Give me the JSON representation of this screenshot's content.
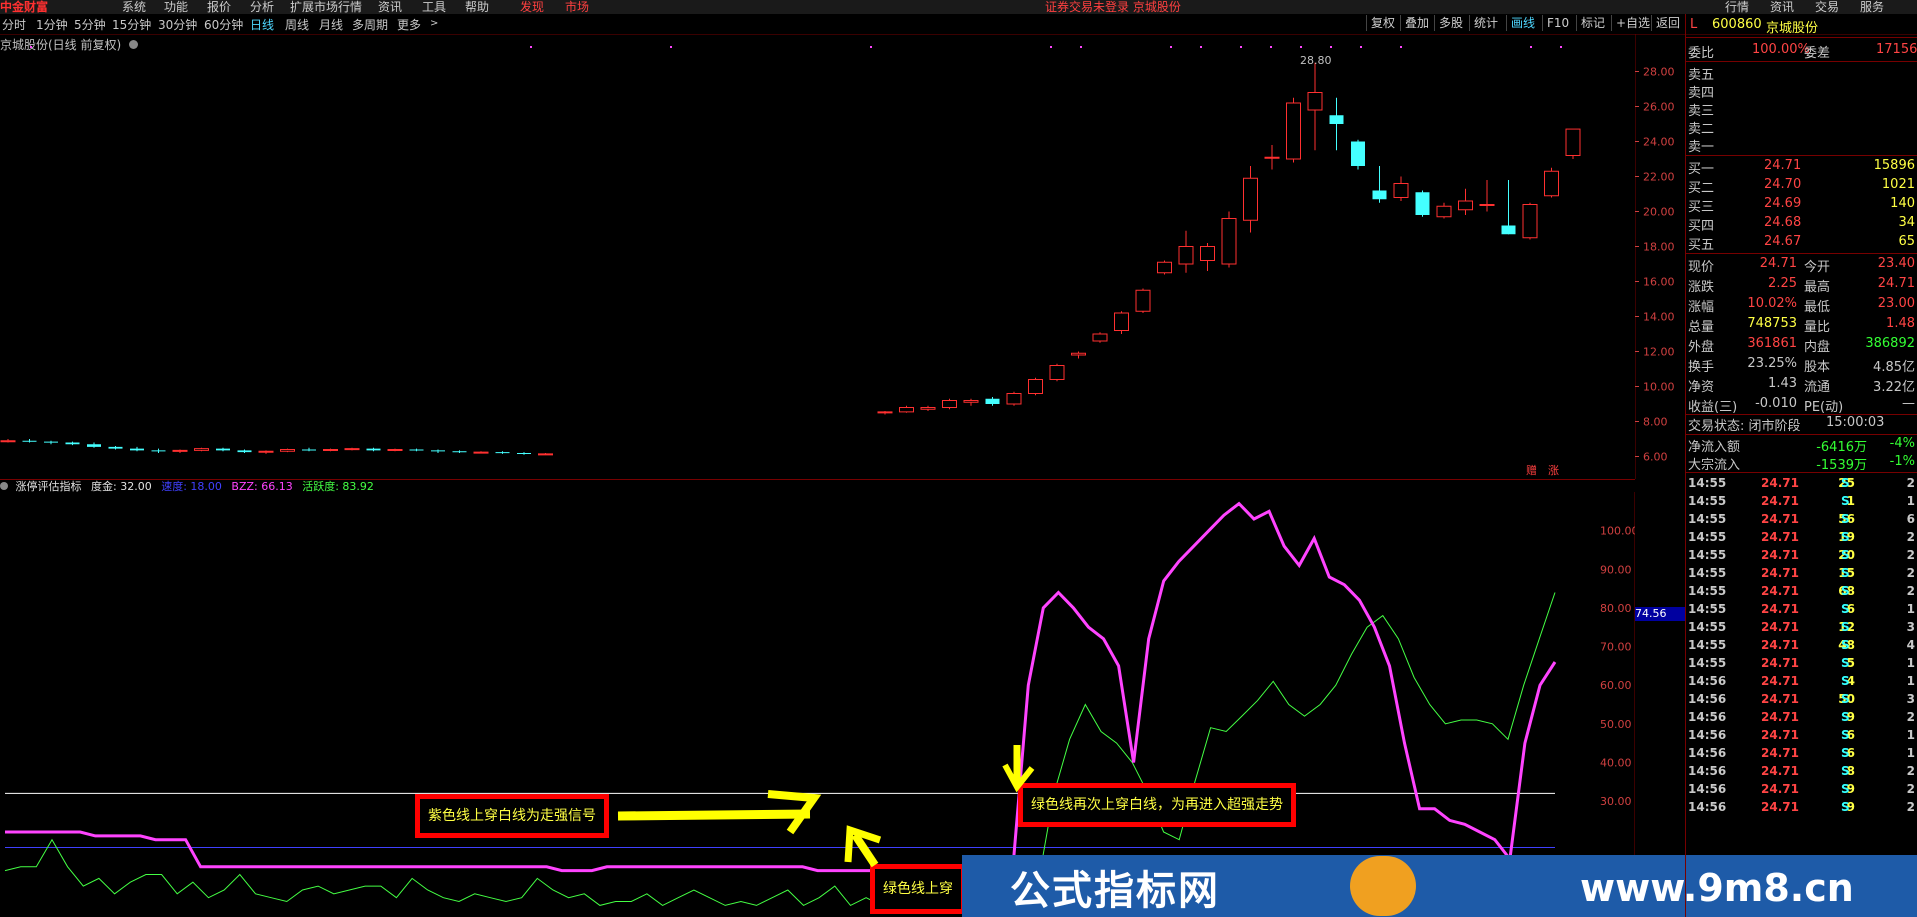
{
  "topbar": {
    "logo": "中金财富",
    "menus": [
      "系统",
      "功能",
      "报价",
      "分析",
      "扩展市场行情",
      "资讯",
      "工具",
      "帮助"
    ],
    "tabs": [
      "发现",
      "市场"
    ],
    "notice": "证券交易未登录 京城股份",
    "right_tabs": [
      "行情",
      "资讯",
      "交易",
      "服务"
    ]
  },
  "periods": {
    "items": [
      "分时",
      "1分钟",
      "5分钟",
      "15分钟",
      "30分钟",
      "60分钟",
      "日线",
      "周线",
      "月线",
      "多周期",
      "更多"
    ],
    "active": "日线",
    "right": [
      "复权",
      "叠加",
      "多股",
      "统计",
      "画线",
      "F10",
      "标记",
      "+自选",
      "返回"
    ]
  },
  "chart_title": "京城股份(日线 前复权)",
  "peak_label": "28.80",
  "indicator": {
    "name": "涨停评估指标",
    "items": [
      {
        "label": "度金: 32.00",
        "color": "#e0e0e0"
      },
      {
        "label": "速度: 18.00",
        "color": "#4040ff"
      },
      {
        "label": "BZZ: 66.13",
        "color": "#ff44ff"
      },
      {
        "label": "活跃度: 83.92",
        "color": "#44ff44"
      }
    ],
    "axis_tag": "74.56"
  },
  "bottom_tags": [
    "赠",
    "涨"
  ],
  "annotations": {
    "purple_cross": "紫色线上穿白线为走强信号",
    "purple_recross": "绿色线再次上穿白线，为再进入超强走势",
    "green_cross": "绿色线上穿"
  },
  "watermark": {
    "text": "公式指标网",
    "url": "www.9m8.cn"
  },
  "stock": {
    "code_prefix": "L",
    "code": "600860",
    "name": "京城股份",
    "weibi_label": "委比",
    "weibi": "100.00%",
    "weicha_label": "委差",
    "weicha": "17156"
  },
  "sell_levels": [
    "卖五",
    "卖四",
    "卖三",
    "卖二",
    "卖一"
  ],
  "buy_levels": [
    {
      "label": "买一",
      "price": "24.71",
      "vol": "15896"
    },
    {
      "label": "买二",
      "price": "24.70",
      "vol": "1021"
    },
    {
      "label": "买三",
      "price": "24.69",
      "vol": "140"
    },
    {
      "label": "买四",
      "price": "24.68",
      "vol": "34"
    },
    {
      "label": "买五",
      "price": "24.67",
      "vol": "65"
    }
  ],
  "quote": [
    {
      "l1": "现价",
      "v1": "24.71",
      "c1": "red",
      "l2": "今开",
      "v2": "23.40",
      "c2": "red"
    },
    {
      "l1": "涨跌",
      "v1": "2.25",
      "c1": "red",
      "l2": "最高",
      "v2": "24.71",
      "c2": "red"
    },
    {
      "l1": "涨幅",
      "v1": "10.02%",
      "c1": "red",
      "l2": "最低",
      "v2": "23.00",
      "c2": "red"
    },
    {
      "l1": "总量",
      "v1": "748753",
      "c1": "yel",
      "l2": "量比",
      "v2": "1.48",
      "c2": "red"
    },
    {
      "l1": "外盘",
      "v1": "361861",
      "c1": "red",
      "l2": "内盘",
      "v2": "386892",
      "c2": "grn"
    },
    {
      "l1": "换手",
      "v1": "23.25%",
      "c1": "lab",
      "l2": "股本",
      "v2": "4.85亿",
      "c2": "lab"
    },
    {
      "l1": "净资",
      "v1": "1.43",
      "c1": "lab",
      "l2": "流通",
      "v2": "3.22亿",
      "c2": "lab"
    },
    {
      "l1": "收益(三)",
      "v1": "-0.010",
      "c1": "lab",
      "l2": "PE(动)",
      "v2": "—",
      "c2": "lab"
    }
  ],
  "trade_state_label": "交易状态: 闭市阶段",
  "trade_state_time": "15:00:03",
  "flows": [
    {
      "label": "净流入额",
      "val": "-6416万",
      "pct": "-4%"
    },
    {
      "label": "大宗流入",
      "val": "-1539万",
      "pct": "-1%"
    }
  ],
  "ticks": [
    {
      "t": "14:55",
      "p": "24.71",
      "v": "25",
      "s": "S",
      "n": "2"
    },
    {
      "t": "14:55",
      "p": "24.71",
      "v": "1",
      "s": "S",
      "n": "1"
    },
    {
      "t": "14:55",
      "p": "24.71",
      "v": "56",
      "s": "S",
      "n": "6"
    },
    {
      "t": "14:55",
      "p": "24.71",
      "v": "19",
      "s": "S",
      "n": "2"
    },
    {
      "t": "14:55",
      "p": "24.71",
      "v": "20",
      "s": "S",
      "n": "2"
    },
    {
      "t": "14:55",
      "p": "24.71",
      "v": "15",
      "s": "S",
      "n": "2"
    },
    {
      "t": "14:55",
      "p": "24.71",
      "v": "68",
      "s": "S",
      "n": "2"
    },
    {
      "t": "14:55",
      "p": "24.71",
      "v": "6",
      "s": "S",
      "n": "1"
    },
    {
      "t": "14:55",
      "p": "24.71",
      "v": "12",
      "s": "S",
      "n": "3"
    },
    {
      "t": "14:55",
      "p": "24.71",
      "v": "48",
      "s": "S",
      "n": "4"
    },
    {
      "t": "14:55",
      "p": "24.71",
      "v": "5",
      "s": "S",
      "n": "1"
    },
    {
      "t": "14:56",
      "p": "24.71",
      "v": "4",
      "s": "S",
      "n": "1"
    },
    {
      "t": "14:56",
      "p": "24.71",
      "v": "50",
      "s": "S",
      "n": "3"
    },
    {
      "t": "14:56",
      "p": "24.71",
      "v": "9",
      "s": "S",
      "n": "2"
    },
    {
      "t": "14:56",
      "p": "24.71",
      "v": "6",
      "s": "S",
      "n": "1"
    },
    {
      "t": "14:56",
      "p": "24.71",
      "v": "6",
      "s": "S",
      "n": "1"
    },
    {
      "t": "14:56",
      "p": "24.71",
      "v": "8",
      "s": "S",
      "n": "2"
    },
    {
      "t": "14:56",
      "p": "24.71",
      "v": "9",
      "s": "S",
      "n": "2"
    },
    {
      "t": "14:56",
      "p": "24.71",
      "v": "9",
      "s": "S",
      "n": "2"
    }
  ],
  "chart_data": [
    {
      "type": "candlestick",
      "ylim": [
        5,
        29
      ],
      "y_ticks": [
        6,
        8,
        10,
        12,
        14,
        16,
        18,
        20,
        22,
        24,
        26,
        28
      ],
      "candles": [
        [
          6.9,
          7.0,
          6.8,
          6.9
        ],
        [
          6.9,
          7.0,
          6.8,
          6.85
        ],
        [
          6.85,
          6.9,
          6.7,
          6.8
        ],
        [
          6.8,
          6.85,
          6.65,
          6.7
        ],
        [
          6.7,
          6.8,
          6.5,
          6.55
        ],
        [
          6.55,
          6.6,
          6.4,
          6.45
        ],
        [
          6.45,
          6.55,
          6.3,
          6.35
        ],
        [
          6.35,
          6.45,
          6.2,
          6.3
        ],
        [
          6.3,
          6.4,
          6.2,
          6.35
        ],
        [
          6.35,
          6.5,
          6.3,
          6.45
        ],
        [
          6.45,
          6.5,
          6.3,
          6.35
        ],
        [
          6.35,
          6.4,
          6.2,
          6.25
        ],
        [
          6.25,
          6.35,
          6.15,
          6.3
        ],
        [
          6.3,
          6.45,
          6.25,
          6.4
        ],
        [
          6.4,
          6.5,
          6.3,
          6.35
        ],
        [
          6.35,
          6.45,
          6.3,
          6.4
        ],
        [
          6.4,
          6.5,
          6.35,
          6.45
        ],
        [
          6.45,
          6.5,
          6.3,
          6.35
        ],
        [
          6.35,
          6.45,
          6.3,
          6.4
        ],
        [
          6.4,
          6.45,
          6.3,
          6.35
        ],
        [
          6.35,
          6.4,
          6.2,
          6.3
        ],
        [
          6.3,
          6.35,
          6.2,
          6.25
        ],
        [
          6.25,
          6.3,
          6.2,
          6.25
        ],
        [
          6.25,
          6.3,
          6.15,
          6.2
        ],
        [
          6.2,
          6.25,
          6.1,
          6.15
        ],
        [
          6.15,
          6.2,
          6.1,
          6.15
        ],
        [
          6.15,
          6.2,
          6.1,
          6.12
        ],
        [
          6.12,
          6.2,
          6.1,
          6.15
        ],
        [
          6.15,
          6.2,
          6.1,
          6.15
        ],
        [
          6.15,
          6.2,
          6.1,
          6.15
        ],
        [
          6.15,
          6.2,
          6.1,
          6.15
        ],
        [
          6.15,
          6.2,
          6.1,
          6.15
        ],
        [
          6.15,
          6.2,
          6.1,
          6.15
        ],
        [
          6.15,
          6.2,
          6.1,
          6.15
        ],
        [
          6.15,
          6.2,
          6.1,
          6.15
        ],
        [
          6.15,
          6.2,
          6.1,
          6.15
        ],
        [
          6.15,
          6.2,
          6.1,
          6.15
        ],
        [
          6.15,
          6.2,
          6.1,
          6.15
        ],
        [
          6.15,
          6.2,
          6.1,
          6.15
        ],
        [
          6.15,
          6.2,
          6.1,
          6.15
        ],
        [
          8.5,
          8.6,
          8.4,
          8.55
        ],
        [
          8.55,
          8.9,
          8.5,
          8.8
        ],
        [
          8.7,
          8.9,
          8.6,
          8.8
        ],
        [
          8.8,
          9.3,
          8.7,
          9.2
        ],
        [
          9.1,
          9.3,
          8.9,
          9.2
        ],
        [
          9.3,
          9.4,
          8.9,
          9.0
        ],
        [
          9.0,
          9.7,
          8.9,
          9.6
        ],
        [
          9.6,
          10.5,
          9.5,
          10.4
        ],
        [
          10.4,
          11.3,
          10.3,
          11.2
        ],
        [
          11.8,
          12.0,
          11.6,
          11.9
        ],
        [
          12.6,
          13.1,
          12.5,
          13.0
        ],
        [
          13.2,
          14.3,
          13.0,
          14.2
        ],
        [
          14.3,
          15.6,
          14.2,
          15.5
        ],
        [
          16.5,
          17.2,
          16.4,
          17.1
        ],
        [
          17.0,
          18.9,
          16.5,
          18.0
        ],
        [
          17.2,
          18.2,
          16.6,
          18.0
        ],
        [
          17.0,
          20.0,
          16.8,
          19.6
        ],
        [
          19.5,
          22.6,
          18.8,
          21.9
        ],
        [
          23.1,
          23.8,
          22.4,
          23.1
        ],
        [
          23.0,
          26.5,
          22.8,
          26.2
        ],
        [
          25.8,
          28.5,
          23.5,
          26.8
        ],
        [
          25.5,
          26.5,
          23.5,
          25.0
        ],
        [
          24.0,
          24.1,
          22.4,
          22.6
        ],
        [
          21.2,
          22.6,
          20.5,
          20.7
        ],
        [
          20.8,
          22.0,
          20.6,
          21.6
        ],
        [
          21.1,
          21.2,
          19.7,
          19.8
        ],
        [
          19.7,
          20.5,
          19.6,
          20.3
        ],
        [
          20.1,
          21.3,
          19.8,
          20.6
        ],
        [
          20.4,
          21.8,
          20.0,
          20.4
        ],
        [
          19.2,
          21.8,
          18.7,
          18.7
        ],
        [
          18.5,
          20.5,
          18.4,
          20.4
        ],
        [
          20.9,
          22.5,
          20.8,
          22.3
        ],
        [
          23.2,
          24.7,
          23.0,
          24.71
        ]
      ]
    },
    {
      "type": "line",
      "ylim": [
        0,
        110
      ],
      "y_ticks": [
        30,
        40,
        50,
        60,
        70,
        80,
        90,
        100
      ],
      "series": [
        {
          "name": "度金",
          "color": "#ffffff",
          "values": [
            32,
            32
          ]
        },
        {
          "name": "速度",
          "color": "#4040ff",
          "values": [
            18,
            18
          ]
        },
        {
          "name": "BZZ",
          "color": "#ff44ff",
          "values": [
            22,
            22,
            22,
            22,
            22,
            22,
            21,
            21,
            21,
            21,
            20,
            20,
            20,
            13,
            13,
            13,
            13,
            13,
            13,
            13,
            13,
            13,
            13,
            13,
            13,
            13,
            13,
            13,
            13,
            13,
            13,
            13,
            13,
            13,
            13,
            13,
            13,
            12,
            12,
            12,
            13,
            13,
            13,
            13,
            13,
            13,
            13,
            13,
            13,
            13,
            13,
            13,
            13,
            13,
            12,
            12,
            12,
            12,
            12,
            12,
            12,
            12,
            12,
            12,
            12,
            12,
            12,
            14,
            60,
            80,
            84,
            80,
            75,
            72,
            65,
            40,
            72,
            87,
            92,
            96,
            100,
            104,
            107,
            103,
            105,
            96,
            91,
            98,
            88,
            86,
            82,
            75,
            65,
            45,
            28,
            28,
            25,
            24,
            22,
            20,
            15,
            45,
            60,
            66
          ]
        },
        {
          "name": "活跃度",
          "color": "#44ff44",
          "values": [
            12,
            13,
            13,
            20,
            13,
            8,
            10,
            6,
            9,
            11,
            11,
            6,
            9,
            5,
            7,
            11,
            6,
            5,
            4,
            7,
            8,
            6,
            7,
            8,
            8,
            5,
            10,
            7,
            5,
            4,
            6,
            5,
            4,
            5,
            10,
            7,
            5,
            6,
            3,
            4,
            4,
            6,
            3,
            5,
            7,
            5,
            3,
            4,
            3,
            5,
            7,
            3,
            5,
            8,
            3,
            5,
            3,
            5,
            4,
            7,
            5,
            3,
            2,
            1,
            4,
            6,
            9,
            32,
            46,
            55,
            48,
            45,
            40,
            32,
            22,
            20,
            35,
            49,
            48,
            52,
            56,
            61,
            55,
            52,
            55,
            60,
            68,
            75,
            78,
            72,
            62,
            55,
            50,
            51,
            51,
            50,
            46,
            60,
            72,
            84
          ]
        }
      ]
    }
  ]
}
